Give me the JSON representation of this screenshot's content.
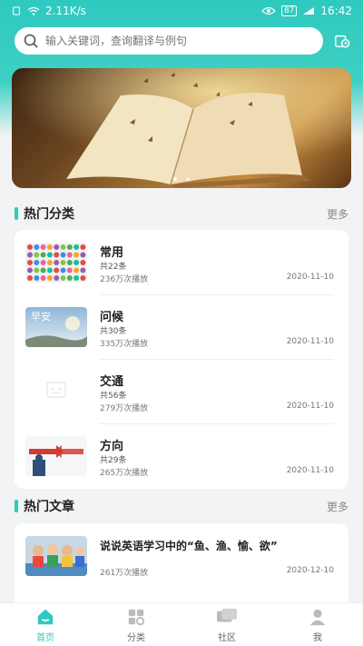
{
  "status_bar": {
    "speed": "2.11K/s",
    "battery": "87",
    "time": "16:42"
  },
  "search": {
    "placeholder": "输入关键词，查询翻译与例句"
  },
  "banner": {
    "dots": 2,
    "active_dot": 0
  },
  "hot_categories": {
    "title": "热门分类",
    "more": "更多",
    "items": [
      {
        "name": "常用",
        "count": "共22条",
        "plays": "236万次播放",
        "date": "2020-11-10",
        "thumb": "colorful-dots"
      },
      {
        "name": "问候",
        "count": "共30条",
        "plays": "335万次播放",
        "date": "2020-11-10",
        "thumb": "good-morning",
        "thumb_text": "早安"
      },
      {
        "name": "交通",
        "count": "共56条",
        "plays": "279万次播放",
        "date": "2020-11-10",
        "thumb": "placeholder"
      },
      {
        "name": "方向",
        "count": "共29条",
        "plays": "265万次播放",
        "date": "2020-11-10",
        "thumb": "arrows"
      }
    ]
  },
  "hot_articles": {
    "title": "热门文章",
    "more": "更多",
    "items": [
      {
        "title": "说说英语学习中的“鱼、渔、愉、欲”",
        "plays": "261万次播放",
        "date": "2020-12-10",
        "thumb": "kids-photo"
      }
    ]
  },
  "tabbar": {
    "items": [
      {
        "label": "首页",
        "icon": "home-icon",
        "active": true
      },
      {
        "label": "分类",
        "icon": "category-icon",
        "active": false
      },
      {
        "label": "社区",
        "icon": "community-icon",
        "active": false
      },
      {
        "label": "我",
        "icon": "profile-icon",
        "active": false
      }
    ]
  },
  "colors": {
    "accent": "#2ec9bf",
    "text": "#222222",
    "muted": "#777777"
  }
}
